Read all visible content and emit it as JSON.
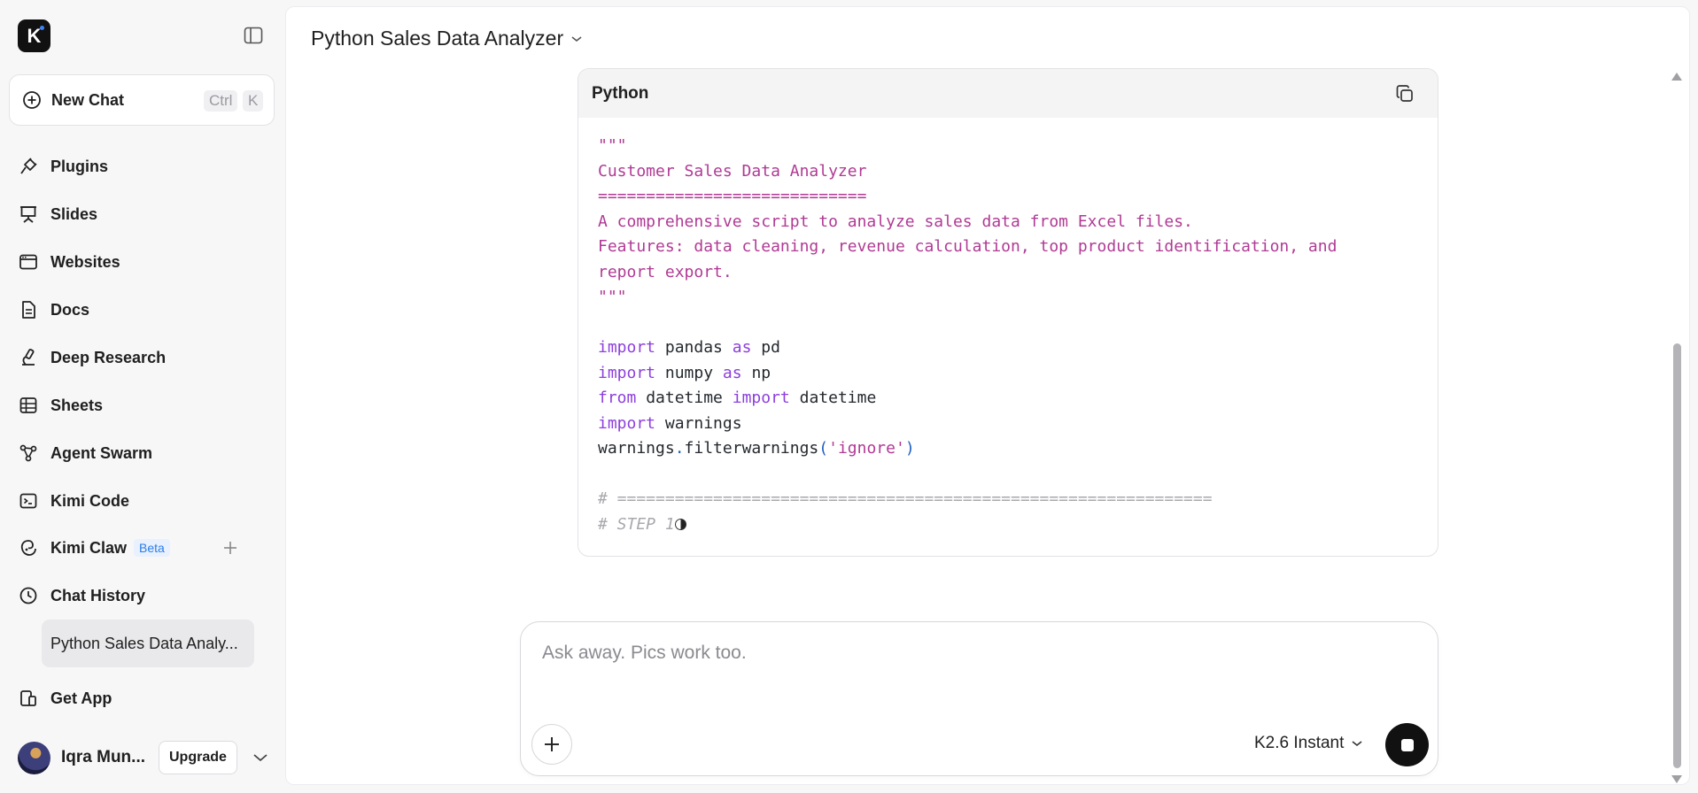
{
  "sidebar": {
    "logo_letter": "K",
    "new_chat": {
      "label": "New Chat",
      "shortcut_mod": "Ctrl",
      "shortcut_key": "K"
    },
    "items": [
      {
        "label": "Plugins",
        "icon": "plug-icon"
      },
      {
        "label": "Slides",
        "icon": "presentation-icon"
      },
      {
        "label": "Websites",
        "icon": "browser-window-icon"
      },
      {
        "label": "Docs",
        "icon": "document-icon"
      },
      {
        "label": "Deep Research",
        "icon": "microscope-icon"
      },
      {
        "label": "Sheets",
        "icon": "table-icon"
      },
      {
        "label": "Agent Swarm",
        "icon": "network-icon"
      },
      {
        "label": "Kimi Code",
        "icon": "terminal-icon"
      },
      {
        "label": "Kimi Claw",
        "icon": "claw-icon",
        "badge": "Beta"
      },
      {
        "label": "Chat History",
        "icon": "clock-icon"
      }
    ],
    "history": [
      "Python Sales Data Analy..."
    ],
    "get_app": "Get App",
    "user": {
      "name": "Iqra Mun...",
      "upgrade_label": "Upgrade"
    }
  },
  "header": {
    "title": "Python Sales Data Analyzer"
  },
  "code_block": {
    "language": "Python",
    "lines": [
      "\"\"\"",
      "Customer Sales Data Analyzer",
      "============================",
      "A comprehensive script to analyze sales data from Excel files.",
      "Features: data cleaning, revenue calculation, top product identification, and",
      "report export.",
      "\"\"\"",
      "",
      "import pandas as pd",
      "import numpy as np",
      "from datetime import datetime",
      "import warnings",
      "warnings.filterwarnings('ignore')",
      "",
      "# ==============================================================",
      "# STEP 1"
    ]
  },
  "composer": {
    "placeholder": "Ask away. Pics work too.",
    "model": "K2.6 Instant"
  },
  "colors": {
    "accent_blue": "#2b7de9",
    "docstring": "#b03a94",
    "keyword": "#8c3fdc",
    "send_button": "#111111"
  }
}
